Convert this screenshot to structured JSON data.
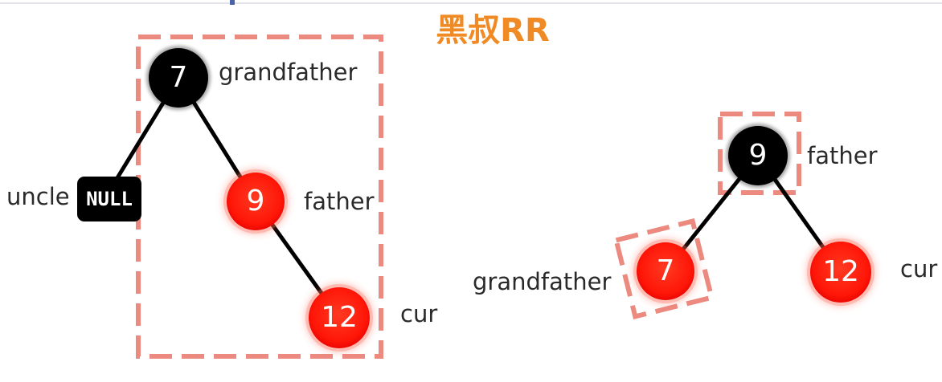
{
  "title": "黑叔RR",
  "colors": {
    "title": "#f08a24",
    "black_node": "#000000",
    "red_node": "#ff1a0a",
    "red_glow": "#ff6b57",
    "dashed_box": "#ec8a80",
    "edge": "#000000",
    "label": "#2a2a2a",
    "null_box": "#000000"
  },
  "left_tree": {
    "grandfather": {
      "value": "7",
      "color": "black",
      "label": "grandfather"
    },
    "uncle": {
      "value": "NULL",
      "label": "uncle"
    },
    "father": {
      "value": "9",
      "color": "red",
      "label": "father"
    },
    "cur": {
      "value": "12",
      "color": "red",
      "label": "cur"
    }
  },
  "right_tree": {
    "father": {
      "value": "9",
      "color": "black",
      "label": "father"
    },
    "grandfather": {
      "value": "7",
      "color": "red",
      "label": "grandfather"
    },
    "cur": {
      "value": "12",
      "color": "red",
      "label": "cur"
    }
  }
}
